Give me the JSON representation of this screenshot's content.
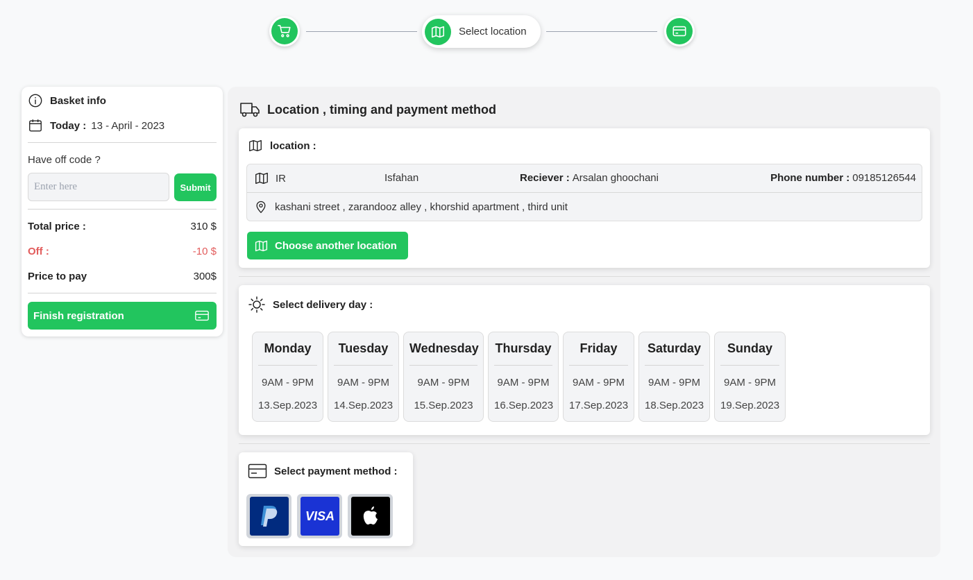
{
  "stepper": {
    "active_label": "Select location",
    "steps": [
      "cart",
      "location",
      "payment"
    ]
  },
  "basket": {
    "title": "Basket info",
    "today_label": "Today :",
    "today_value": "13 - April - 2023",
    "off_question": "Have off code ?",
    "code_placeholder": "Enter here",
    "submit_label": "Submit",
    "total_label": "Total price :",
    "total_value": "310 $",
    "off_label": "Off :",
    "off_value": "-10 $",
    "pay_label": "Price to pay",
    "pay_value": "300$",
    "finish_label": "Finish registration"
  },
  "main": {
    "title": "Location , timing and payment method",
    "location": {
      "heading": "location :",
      "country": "IR",
      "city": "Isfahan",
      "receiver_label": "Reciever :",
      "receiver_value": "Arsalan ghoochani",
      "phone_label": "Phone number :",
      "phone_value": "09185126544",
      "address": "kashani street , zarandooz alley , khorshid apartment , third unit",
      "choose_label": "Choose another location"
    },
    "delivery": {
      "heading": "Select delivery day :",
      "days": [
        {
          "name": "Monday",
          "time": "9AM - 9PM",
          "date": "13.Sep.2023"
        },
        {
          "name": "Tuesday",
          "time": "9AM - 9PM",
          "date": "14.Sep.2023"
        },
        {
          "name": "Wednesday",
          "time": "9AM - 9PM",
          "date": "15.Sep.2023"
        },
        {
          "name": "Thursday",
          "time": "9AM - 9PM",
          "date": "16.Sep.2023"
        },
        {
          "name": "Friday",
          "time": "9AM - 9PM",
          "date": "17.Sep.2023"
        },
        {
          "name": "Saturday",
          "time": "9AM - 9PM",
          "date": "18.Sep.2023"
        },
        {
          "name": "Sunday",
          "time": "9AM - 9PM",
          "date": "19.Sep.2023"
        }
      ]
    },
    "payment": {
      "heading": "Select payment method :",
      "methods": [
        "paypal",
        "visa",
        "apple-pay"
      ]
    }
  },
  "colors": {
    "accent": "#22c55e",
    "danger": "#e25c5c",
    "paypal_bg": "#012b7f",
    "visa_bg": "#1a33d4",
    "apple_bg": "#000000"
  }
}
